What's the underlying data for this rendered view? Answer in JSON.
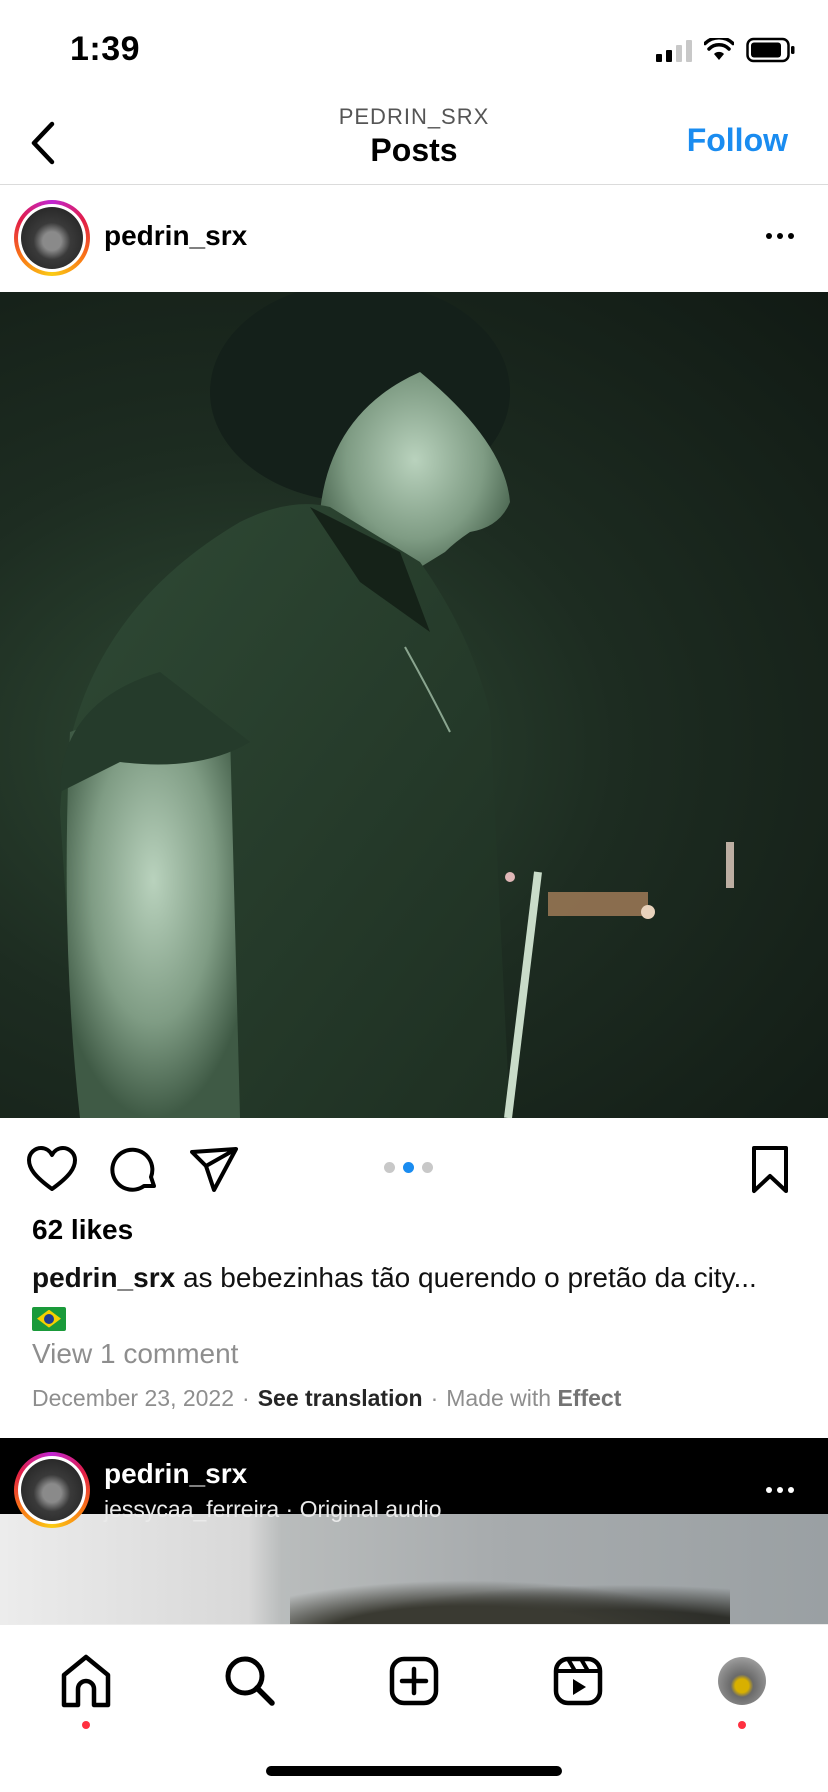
{
  "status_bar": {
    "time": "1:39",
    "icons": [
      "cellular-signal-icon",
      "wifi-icon",
      "battery-icon"
    ]
  },
  "header": {
    "subtitle": "PEDRIN_SRX",
    "title": "Posts",
    "follow_label": "Follow",
    "back_icon": "chevron-left-icon",
    "accent_color": "#1a8cf0"
  },
  "post": {
    "username": "pedrin_srx",
    "more_icon": "more-horizontal-icon",
    "carousel": {
      "count": 3,
      "active_index": 1
    },
    "actions": [
      "heart-icon",
      "comment-icon",
      "share-icon",
      "bookmark-icon"
    ],
    "likes": "62 likes",
    "caption_user": "pedrin_srx",
    "caption_text": "as bebezinhas tão querendo o pretão da city...",
    "caption_emoji": "brazil-flag-icon",
    "view_comments": "View 1 comment",
    "date": "December 23, 2022",
    "see_translation": "See translation",
    "made_with_prefix": "Made with",
    "made_with_effect": "Effect"
  },
  "next_post": {
    "username": "pedrin_srx",
    "audio": "jessycaa_ferreira · Original audio"
  },
  "bottom_nav": {
    "items": [
      "home-icon",
      "search-icon",
      "create-icon",
      "reels-icon",
      "profile-avatar"
    ],
    "notification_color": "#ff3040"
  }
}
